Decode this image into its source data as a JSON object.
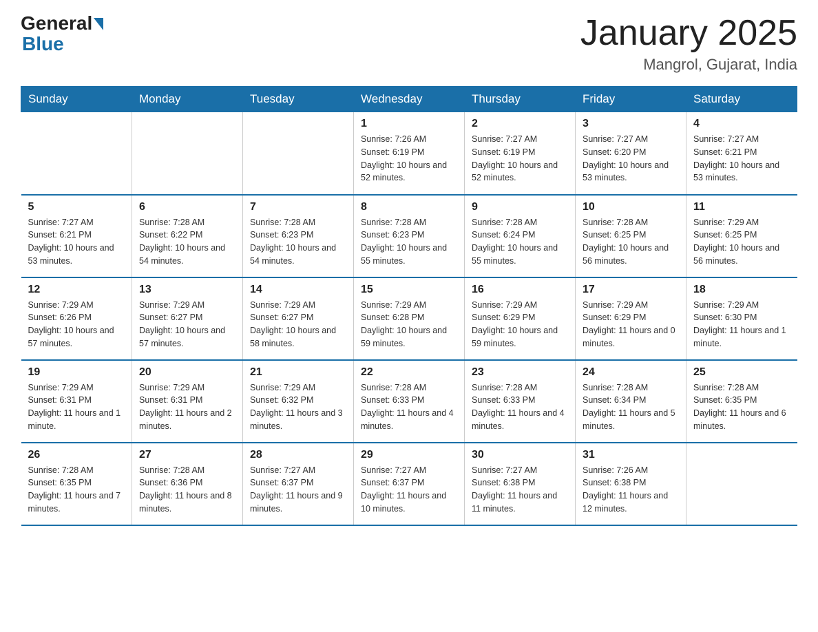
{
  "header": {
    "logo_general": "General",
    "logo_blue": "Blue",
    "month_title": "January 2025",
    "location": "Mangrol, Gujarat, India"
  },
  "weekdays": [
    "Sunday",
    "Monday",
    "Tuesday",
    "Wednesday",
    "Thursday",
    "Friday",
    "Saturday"
  ],
  "weeks": [
    [
      {
        "day": "",
        "sunrise": "",
        "sunset": "",
        "daylight": ""
      },
      {
        "day": "",
        "sunrise": "",
        "sunset": "",
        "daylight": ""
      },
      {
        "day": "",
        "sunrise": "",
        "sunset": "",
        "daylight": ""
      },
      {
        "day": "1",
        "sunrise": "Sunrise: 7:26 AM",
        "sunset": "Sunset: 6:19 PM",
        "daylight": "Daylight: 10 hours and 52 minutes."
      },
      {
        "day": "2",
        "sunrise": "Sunrise: 7:27 AM",
        "sunset": "Sunset: 6:19 PM",
        "daylight": "Daylight: 10 hours and 52 minutes."
      },
      {
        "day": "3",
        "sunrise": "Sunrise: 7:27 AM",
        "sunset": "Sunset: 6:20 PM",
        "daylight": "Daylight: 10 hours and 53 minutes."
      },
      {
        "day": "4",
        "sunrise": "Sunrise: 7:27 AM",
        "sunset": "Sunset: 6:21 PM",
        "daylight": "Daylight: 10 hours and 53 minutes."
      }
    ],
    [
      {
        "day": "5",
        "sunrise": "Sunrise: 7:27 AM",
        "sunset": "Sunset: 6:21 PM",
        "daylight": "Daylight: 10 hours and 53 minutes."
      },
      {
        "day": "6",
        "sunrise": "Sunrise: 7:28 AM",
        "sunset": "Sunset: 6:22 PM",
        "daylight": "Daylight: 10 hours and 54 minutes."
      },
      {
        "day": "7",
        "sunrise": "Sunrise: 7:28 AM",
        "sunset": "Sunset: 6:23 PM",
        "daylight": "Daylight: 10 hours and 54 minutes."
      },
      {
        "day": "8",
        "sunrise": "Sunrise: 7:28 AM",
        "sunset": "Sunset: 6:23 PM",
        "daylight": "Daylight: 10 hours and 55 minutes."
      },
      {
        "day": "9",
        "sunrise": "Sunrise: 7:28 AM",
        "sunset": "Sunset: 6:24 PM",
        "daylight": "Daylight: 10 hours and 55 minutes."
      },
      {
        "day": "10",
        "sunrise": "Sunrise: 7:28 AM",
        "sunset": "Sunset: 6:25 PM",
        "daylight": "Daylight: 10 hours and 56 minutes."
      },
      {
        "day": "11",
        "sunrise": "Sunrise: 7:29 AM",
        "sunset": "Sunset: 6:25 PM",
        "daylight": "Daylight: 10 hours and 56 minutes."
      }
    ],
    [
      {
        "day": "12",
        "sunrise": "Sunrise: 7:29 AM",
        "sunset": "Sunset: 6:26 PM",
        "daylight": "Daylight: 10 hours and 57 minutes."
      },
      {
        "day": "13",
        "sunrise": "Sunrise: 7:29 AM",
        "sunset": "Sunset: 6:27 PM",
        "daylight": "Daylight: 10 hours and 57 minutes."
      },
      {
        "day": "14",
        "sunrise": "Sunrise: 7:29 AM",
        "sunset": "Sunset: 6:27 PM",
        "daylight": "Daylight: 10 hours and 58 minutes."
      },
      {
        "day": "15",
        "sunrise": "Sunrise: 7:29 AM",
        "sunset": "Sunset: 6:28 PM",
        "daylight": "Daylight: 10 hours and 59 minutes."
      },
      {
        "day": "16",
        "sunrise": "Sunrise: 7:29 AM",
        "sunset": "Sunset: 6:29 PM",
        "daylight": "Daylight: 10 hours and 59 minutes."
      },
      {
        "day": "17",
        "sunrise": "Sunrise: 7:29 AM",
        "sunset": "Sunset: 6:29 PM",
        "daylight": "Daylight: 11 hours and 0 minutes."
      },
      {
        "day": "18",
        "sunrise": "Sunrise: 7:29 AM",
        "sunset": "Sunset: 6:30 PM",
        "daylight": "Daylight: 11 hours and 1 minute."
      }
    ],
    [
      {
        "day": "19",
        "sunrise": "Sunrise: 7:29 AM",
        "sunset": "Sunset: 6:31 PM",
        "daylight": "Daylight: 11 hours and 1 minute."
      },
      {
        "day": "20",
        "sunrise": "Sunrise: 7:29 AM",
        "sunset": "Sunset: 6:31 PM",
        "daylight": "Daylight: 11 hours and 2 minutes."
      },
      {
        "day": "21",
        "sunrise": "Sunrise: 7:29 AM",
        "sunset": "Sunset: 6:32 PM",
        "daylight": "Daylight: 11 hours and 3 minutes."
      },
      {
        "day": "22",
        "sunrise": "Sunrise: 7:28 AM",
        "sunset": "Sunset: 6:33 PM",
        "daylight": "Daylight: 11 hours and 4 minutes."
      },
      {
        "day": "23",
        "sunrise": "Sunrise: 7:28 AM",
        "sunset": "Sunset: 6:33 PM",
        "daylight": "Daylight: 11 hours and 4 minutes."
      },
      {
        "day": "24",
        "sunrise": "Sunrise: 7:28 AM",
        "sunset": "Sunset: 6:34 PM",
        "daylight": "Daylight: 11 hours and 5 minutes."
      },
      {
        "day": "25",
        "sunrise": "Sunrise: 7:28 AM",
        "sunset": "Sunset: 6:35 PM",
        "daylight": "Daylight: 11 hours and 6 minutes."
      }
    ],
    [
      {
        "day": "26",
        "sunrise": "Sunrise: 7:28 AM",
        "sunset": "Sunset: 6:35 PM",
        "daylight": "Daylight: 11 hours and 7 minutes."
      },
      {
        "day": "27",
        "sunrise": "Sunrise: 7:28 AM",
        "sunset": "Sunset: 6:36 PM",
        "daylight": "Daylight: 11 hours and 8 minutes."
      },
      {
        "day": "28",
        "sunrise": "Sunrise: 7:27 AM",
        "sunset": "Sunset: 6:37 PM",
        "daylight": "Daylight: 11 hours and 9 minutes."
      },
      {
        "day": "29",
        "sunrise": "Sunrise: 7:27 AM",
        "sunset": "Sunset: 6:37 PM",
        "daylight": "Daylight: 11 hours and 10 minutes."
      },
      {
        "day": "30",
        "sunrise": "Sunrise: 7:27 AM",
        "sunset": "Sunset: 6:38 PM",
        "daylight": "Daylight: 11 hours and 11 minutes."
      },
      {
        "day": "31",
        "sunrise": "Sunrise: 7:26 AM",
        "sunset": "Sunset: 6:38 PM",
        "daylight": "Daylight: 11 hours and 12 minutes."
      },
      {
        "day": "",
        "sunrise": "",
        "sunset": "",
        "daylight": ""
      }
    ]
  ]
}
